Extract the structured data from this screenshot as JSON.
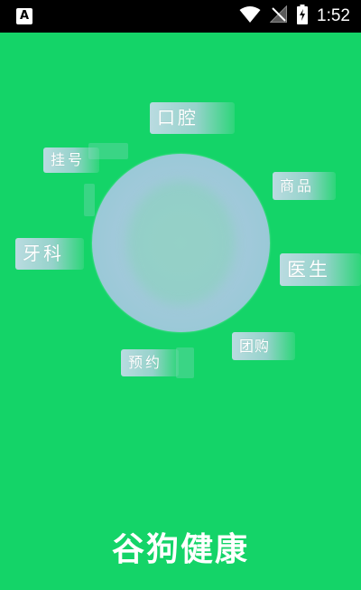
{
  "status_bar": {
    "left_icon": "a-icon",
    "left_glyph": "A",
    "wifi_icon": "wifi-icon",
    "signal_icon": "signal-off-icon",
    "battery_icon": "battery-charging-icon",
    "time": "1:52"
  },
  "tags": {
    "kouqiang": "口腔",
    "guahao": "挂号",
    "shangpin": "商品",
    "yake": "牙科",
    "yisheng": "医生",
    "tuangou": "团购",
    "yuyue": "预约"
  },
  "app": {
    "title": "谷狗健康"
  },
  "colors": {
    "background": "#14d468",
    "status_bar": "#000000",
    "tag_text": "#ffffff"
  }
}
